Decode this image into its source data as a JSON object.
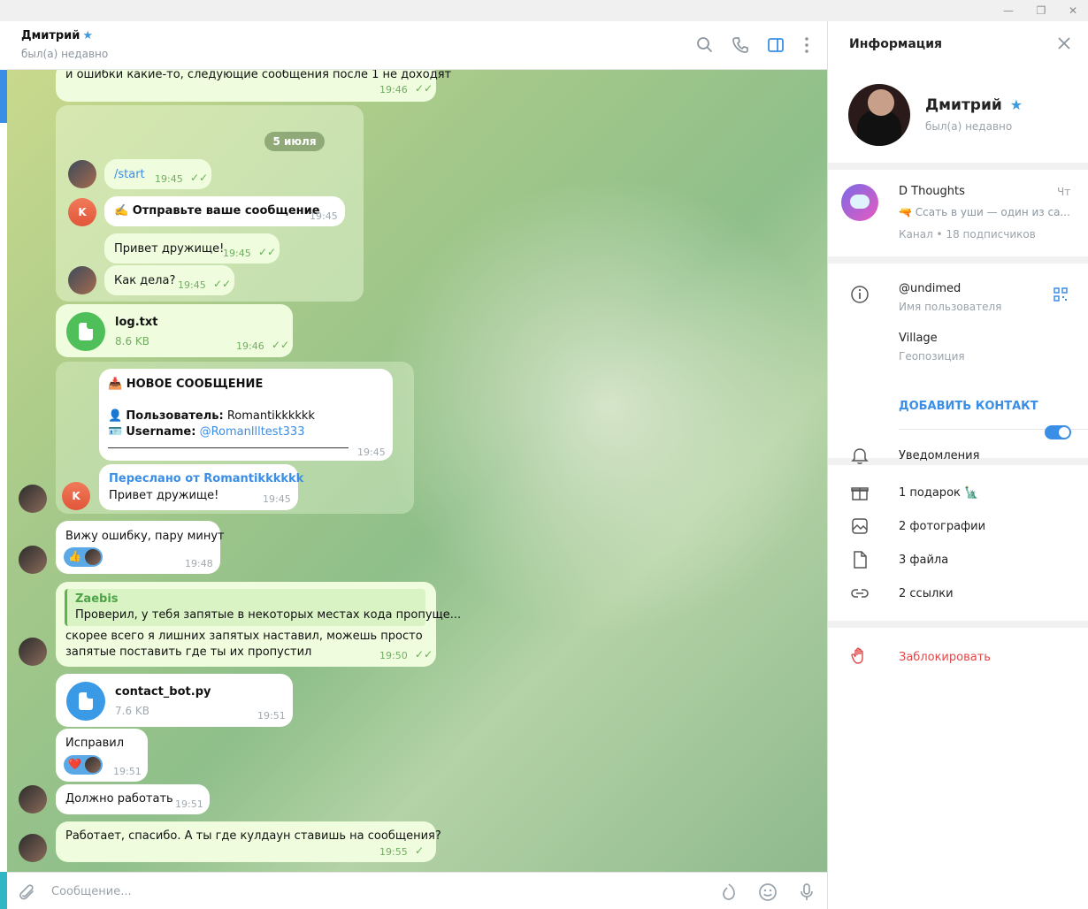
{
  "window": {
    "minimize": "—",
    "restore": "❐",
    "close": "✕"
  },
  "header": {
    "title": "Дмитрий",
    "status": "был(а) недавно"
  },
  "date_divider": "5 июля",
  "messages": {
    "m0": {
      "text": "и ошибки какие-то, следующие сообщения после 1 не доходят",
      "time": "19:46"
    },
    "m1": {
      "text": "/start",
      "time": "19:45"
    },
    "m2": {
      "emoji": "✍️",
      "text": "Отправьте ваше сообщение",
      "time": "19:45"
    },
    "m3": {
      "text": "Привет дружище!",
      "time": "19:45"
    },
    "m4": {
      "text": "Как дела?",
      "time": "19:45"
    },
    "m5": {
      "name": "log.txt",
      "size": "8.6 KB",
      "time": "19:46"
    },
    "m6": {
      "title": "НОВОЕ СООБЩЕНИЕ",
      "user_label": "Пользователь:",
      "user_value": "Romantikkkkkk",
      "username_label": "Username:",
      "username_value": "@Romanllltest333",
      "time": "19:45"
    },
    "m7": {
      "fwd": "Переслано от Romantikkkkkk",
      "text": "Привет дружище!",
      "time": "19:45"
    },
    "m8": {
      "text": "Вижу ошибку, пару минут",
      "time": "19:48",
      "reaction": "👍"
    },
    "m9": {
      "quote_author": "Zaebis",
      "quote_text": "Проверил, у тебя запятые в некоторых местах кода пропуще...",
      "line1": "скорее всего я лишних запятых наставил, можешь просто",
      "line2": "запятые поставить где ты их пропустил",
      "time": "19:50"
    },
    "m10": {
      "name": "contact_bot.py",
      "size": "7.6 KB",
      "time": "19:51"
    },
    "m11": {
      "text": "Исправил",
      "time": "19:51",
      "reaction": "❤️"
    },
    "m12": {
      "text": "Должно работать",
      "time": "19:51"
    },
    "m13": {
      "text": "Работает, спасибо. А ты где кулдаун ставишь на сообщения?",
      "time": "19:55"
    }
  },
  "composer": {
    "placeholder": "Сообщение..."
  },
  "info": {
    "title": "Информация",
    "name": "Дмитрий",
    "status": "был(а) недавно",
    "channel": {
      "name": "D Thoughts",
      "day": "Чт",
      "preview": "Ссать в уши — один из са...",
      "subscribers": "Канал • 18 подписчиков"
    },
    "username": "@undimed",
    "username_label": "Имя пользователя",
    "location": "Village",
    "location_label": "Геопозиция",
    "add_contact": "ДОБАВИТЬ КОНТАКТ",
    "notifications": "Уведомления",
    "notifications_on": true,
    "media": {
      "gifts": "1 подарок",
      "photos": "2 фотографии",
      "files": "3 файла",
      "links": "2 ссылки"
    },
    "block": "Заблокировать"
  },
  "colors": {
    "accent": "#3a8ee6",
    "outgoing_bubble": "#effdde",
    "check": "#5fb34e",
    "danger": "#e04848"
  }
}
